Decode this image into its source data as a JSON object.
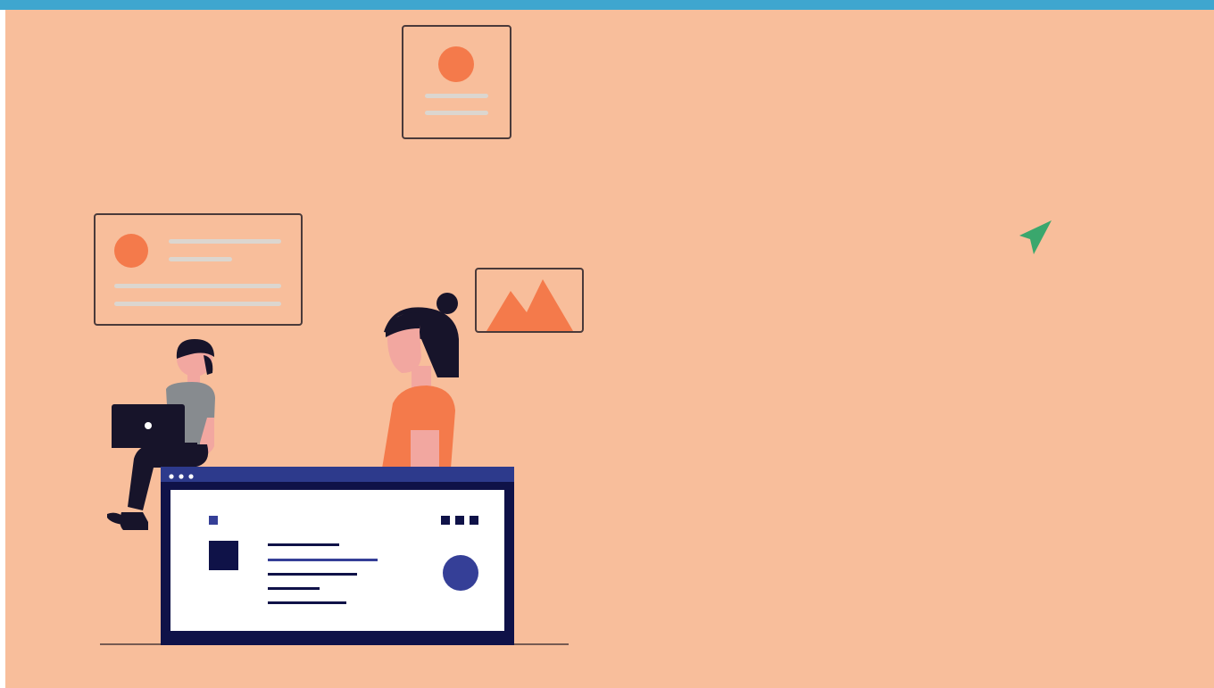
{
  "colors": {
    "top_bar": "#3fa6cf",
    "background": "#f8be9b",
    "accent_orange": "#f47a4b",
    "frame_stroke": "#4a3a3a",
    "navy": "#1a1f5c",
    "navy_dark": "#0f1248",
    "blue_circle": "#353f97",
    "card_line": "#dcd6cf",
    "cursor_green": "#3aa76d",
    "hair": "#17142a",
    "skin": "#f2a7a0"
  },
  "icons": {
    "cursor": "navigation-arrow-icon"
  }
}
